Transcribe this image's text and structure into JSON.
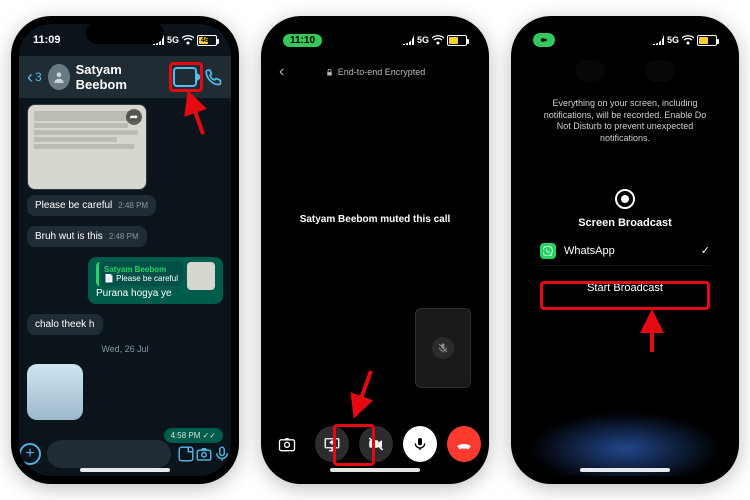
{
  "phone1": {
    "status": {
      "time": "11:09",
      "battery_pct": "46",
      "network": "5G"
    },
    "header": {
      "back_count": "3",
      "contact_name": "Satyam Beebom"
    },
    "messages": {
      "m1": {
        "text": "Please be careful",
        "time": "2:48 PM"
      },
      "m2": {
        "text": "Bruh wut is this",
        "time": "2:48 PM"
      },
      "reply": {
        "name": "Satyam Beebom",
        "quoted": "📄 Please be careful",
        "text": "Purana hogya ye"
      },
      "reply_thumb_hint": "document-thumb",
      "m4": {
        "text": "chalo theek h"
      },
      "date": "Wed, 26 Jul",
      "out_time": "4:58 PM ✓✓"
    }
  },
  "phone2": {
    "status": {
      "time": "11:10"
    },
    "header": {
      "encryption": "End-to-end Encrypted"
    },
    "center_text": "Satyam Beebom muted this call"
  },
  "phone3": {
    "info": "Everything on your screen, including notifications, will be recorded. Enable Do Not Disturb to prevent unexpected notifications.",
    "broadcast_label": "Screen Broadcast",
    "app_name": "WhatsApp",
    "start_label": "Start Broadcast"
  }
}
